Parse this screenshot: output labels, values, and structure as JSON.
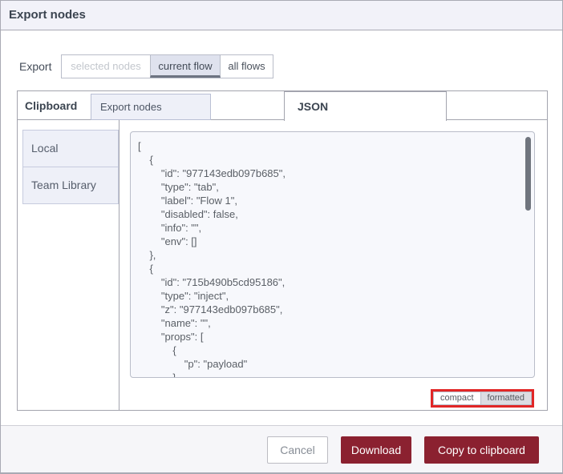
{
  "dialog": {
    "title": "Export nodes"
  },
  "export_row": {
    "label": "Export",
    "options": [
      {
        "label": "selected nodes",
        "state": "disabled"
      },
      {
        "label": "current flow",
        "state": "selected"
      },
      {
        "label": "all flows",
        "state": "normal"
      }
    ]
  },
  "tabs": {
    "section_label": "Clipboard",
    "items": [
      {
        "label": "Export nodes",
        "active": false
      },
      {
        "label": "JSON",
        "active": true
      }
    ]
  },
  "library_sidebar": {
    "items": [
      {
        "label": "Local"
      },
      {
        "label": "Team Library"
      }
    ]
  },
  "editor": {
    "json_lines": [
      "[",
      "    {",
      "        \"id\": \"977143edb097b685\",",
      "        \"type\": \"tab\",",
      "        \"label\": \"Flow 1\",",
      "        \"disabled\": false,",
      "        \"info\": \"\",",
      "        \"env\": []",
      "    },",
      "    {",
      "        \"id\": \"715b490b5cd95186\",",
      "        \"type\": \"inject\",",
      "        \"z\": \"977143edb097b685\",",
      "        \"name\": \"\",",
      "        \"props\": [",
      "            {",
      "                \"p\": \"payload\"",
      "            },"
    ],
    "format_toggle": {
      "options": [
        {
          "label": "compact",
          "selected": false
        },
        {
          "label": "formatted",
          "selected": true
        }
      ],
      "highlight_color": "#e12626"
    }
  },
  "footer": {
    "buttons": [
      {
        "label": "Cancel",
        "style": "secondary"
      },
      {
        "label": "Download",
        "style": "primary"
      },
      {
        "label": "Copy to clipboard",
        "style": "primary"
      }
    ]
  },
  "colors": {
    "accent_maroon": "#8b2130",
    "highlight_red": "#e12626",
    "lavender": "#eef0f8",
    "titlebar_bg": "#f2f2f9",
    "selected_segment_bg": "#dfe2ee"
  }
}
